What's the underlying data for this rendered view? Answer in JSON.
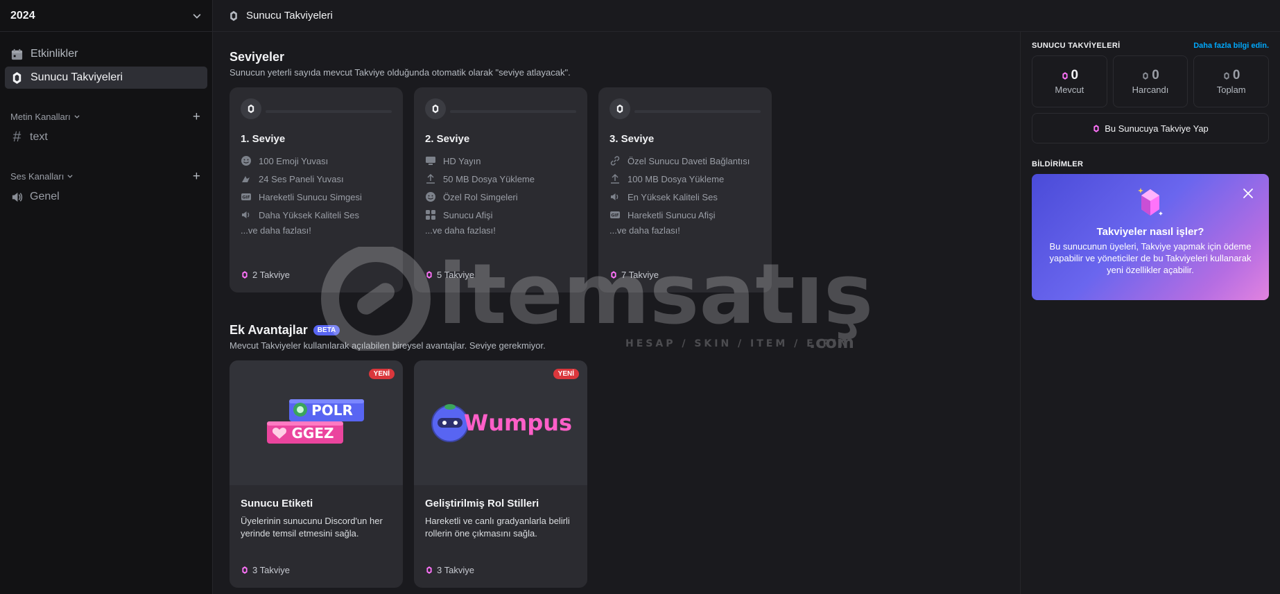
{
  "sidebar": {
    "server_name": "2024",
    "nav": [
      {
        "label": "Etkinlikler"
      },
      {
        "label": "Sunucu Takviyeleri"
      }
    ],
    "text_category": "Metin Kanalları",
    "text_channel": "text",
    "voice_category": "Ses Kanalları",
    "voice_channel": "Genel"
  },
  "topbar": {
    "title": "Sunucu Takviyeleri"
  },
  "levels": {
    "title": "Seviyeler",
    "subtitle": "Sunucun yeterli sayıda mevcut Takviye olduğunda otomatik olarak \"seviye atlayacak\".",
    "tiers": [
      {
        "title": "1. Seviye",
        "perks": [
          "100 Emoji Yuvası",
          "24 Ses Paneli Yuvası",
          "Hareketli Sunucu Simgesi",
          "Daha Yüksek Kaliteli Ses"
        ],
        "more": "...ve daha fazlası!",
        "requirement": "2 Takviye"
      },
      {
        "title": "2. Seviye",
        "perks": [
          "HD Yayın",
          "50 MB Dosya Yükleme",
          "Özel Rol Simgeleri",
          "Sunucu Afişi"
        ],
        "more": "...ve daha fazlası!",
        "requirement": "5 Takviye"
      },
      {
        "title": "3. Seviye",
        "perks": [
          "Özel Sunucu Daveti Bağlantısı",
          "100 MB Dosya Yükleme",
          "En Yüksek Kaliteli Ses",
          "Hareketli Sunucu Afişi"
        ],
        "more": "...ve daha fazlası!",
        "requirement": "7 Takviye"
      }
    ]
  },
  "extras": {
    "title": "Ek Avantajlar",
    "badge": "BETA",
    "subtitle": "Mevcut Takviyeler kullanılarak açılabilen bireysel avantajlar. Seviye gerekmiyor.",
    "cards": [
      {
        "badge": "YENİ",
        "art_tags": [
          "POLR",
          "GGEZ"
        ],
        "title": "Sunucu Etiketi",
        "desc": "Üyelerinin sunucunu Discord'un her yerinde temsil etmesini sağla.",
        "requirement": "3 Takviye"
      },
      {
        "badge": "YENİ",
        "art_text": "Wumpus",
        "title": "Geliştirilmiş Rol Stilleri",
        "desc": "Hareketli ve canlı gradyanlarla belirli rollerin öne çıkmasını sağla.",
        "requirement": "3 Takviye"
      }
    ]
  },
  "watermark": {
    "brand": "itemsatış",
    "tagline": "HESAP / SKIN / ITEM / E-PIN",
    "domain": ".com"
  },
  "rpanel": {
    "label": "SUNUCU TAKVİYELERİ",
    "link": "Daha fazla bilgi edin.",
    "stats": [
      {
        "value": "0",
        "label": "Mevcut"
      },
      {
        "value": "0",
        "label": "Harcandı"
      },
      {
        "value": "0",
        "label": "Toplam"
      }
    ],
    "boost_button": "Bu Sunucuya Takviye Yap",
    "notif_label": "BİLDİRİMLER",
    "notif_title": "Takviyeler nasıl işler?",
    "notif_text": "Bu sunucunun üyeleri, Takviye yapmak için ödeme yapabilir ve yöneticiler de bu Takviyeleri kullanarak yeni özellikler açabilir."
  },
  "colors": {
    "accent": "#5865f2",
    "boost_pink": "#ff73fa",
    "danger": "#da373c",
    "link": "#00a8fc"
  }
}
